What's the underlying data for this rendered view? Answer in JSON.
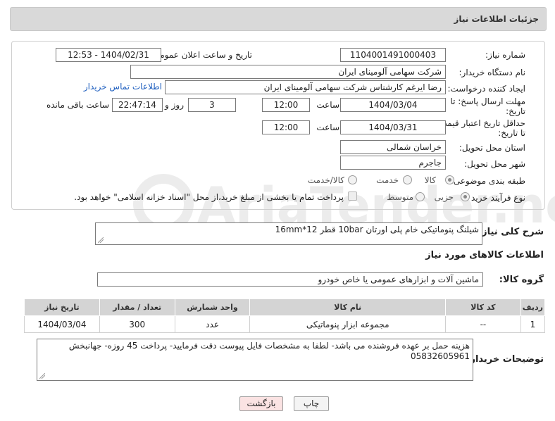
{
  "header": {
    "title": "جزئیات اطلاعات نیاز"
  },
  "form": {
    "need_number": {
      "label": "شماره نیاز:",
      "value": "1104001491000403"
    },
    "announce": {
      "label": "تاریخ و ساعت اعلان عمومی:",
      "value": "1404/02/31 - 12:53"
    },
    "buyer": {
      "label": "نام دستگاه خریدار:",
      "value": "شرکت سهامی آلومینای ایران"
    },
    "creator": {
      "label": "ایجاد کننده درخواست:",
      "value": "رضا ایرغم کارشناس شرکت سهامی آلومینای ایران",
      "contact_link": "اطلاعات تماس خریدار"
    },
    "deadline": {
      "label_line1": "مهلت ارسال پاسخ: تا",
      "label_line2": "تاریخ:",
      "date": "1404/03/04",
      "time_label": "ساعت",
      "time": "12:00",
      "days": "3",
      "days_label": "روز و",
      "remaining": "22:47:14",
      "remaining_label": "ساعت باقی مانده"
    },
    "validity": {
      "label_line1": "حداقل تاریخ اعتبار قیمت:",
      "label_line2": "تا تاریخ:",
      "date": "1404/03/31",
      "time_label": "ساعت",
      "time": "12:00"
    },
    "province": {
      "label": "استان محل تحویل:",
      "value": "خراسان شمالی"
    },
    "city": {
      "label": "شهر محل تحویل:",
      "value": "جاجرم"
    },
    "category": {
      "label": "طبقه بندی موضوعی:",
      "options": [
        "کالا",
        "خدمت",
        "کالا/خدمت"
      ],
      "selected": "کالا"
    },
    "process": {
      "label": "نوع فرآیند خرید :",
      "options": [
        "جزیی",
        "متوسط"
      ],
      "selected": "جزیی",
      "note": "پرداخت تمام یا بخشی از مبلغ خرید،از محل \"اسناد خزانه اسلامی\" خواهد بود."
    }
  },
  "description": {
    "label": "شرح کلی نیاز:",
    "value": "شیلنگ پنوماتیکی خام پلی اورتان 10bar قطر 12*16mm"
  },
  "goods_section": {
    "title": "اطلاعات کالاهای مورد نیاز"
  },
  "goods_group": {
    "label": "گروه کالا:",
    "value": "ماشین آلات و ابزارهای عمومی یا خاص خودرو"
  },
  "table": {
    "columns": [
      "ردیف",
      "کد کالا",
      "نام کالا",
      "واحد شمارش",
      "تعداد / مقدار",
      "تاریخ نیاز"
    ],
    "rows": [
      [
        "1",
        "--",
        "مجموعه ابزار پنوماتیکی",
        "عدد",
        "300",
        "1404/03/04"
      ]
    ]
  },
  "buyer_notes": {
    "label": "توضیحات خریدار:",
    "value": "هزینه حمل بر عهده فروشنده می باشد- لطفا به مشخصات فایل پیوست دقت فرمایید- پرداخت 45 روزه- جهانبخش 05832605961"
  },
  "buttons": {
    "print": "چاپ",
    "back": "بازگشت"
  },
  "watermark": {
    "text": "AriaTender.neT"
  },
  "colors": {
    "link": "#1f5fbf",
    "back_button_bg": "#fbe3e3",
    "header_bg": "#d9d9d9",
    "table_header_bg": "#d4d4d4",
    "watermark": "#e9e9e9"
  }
}
